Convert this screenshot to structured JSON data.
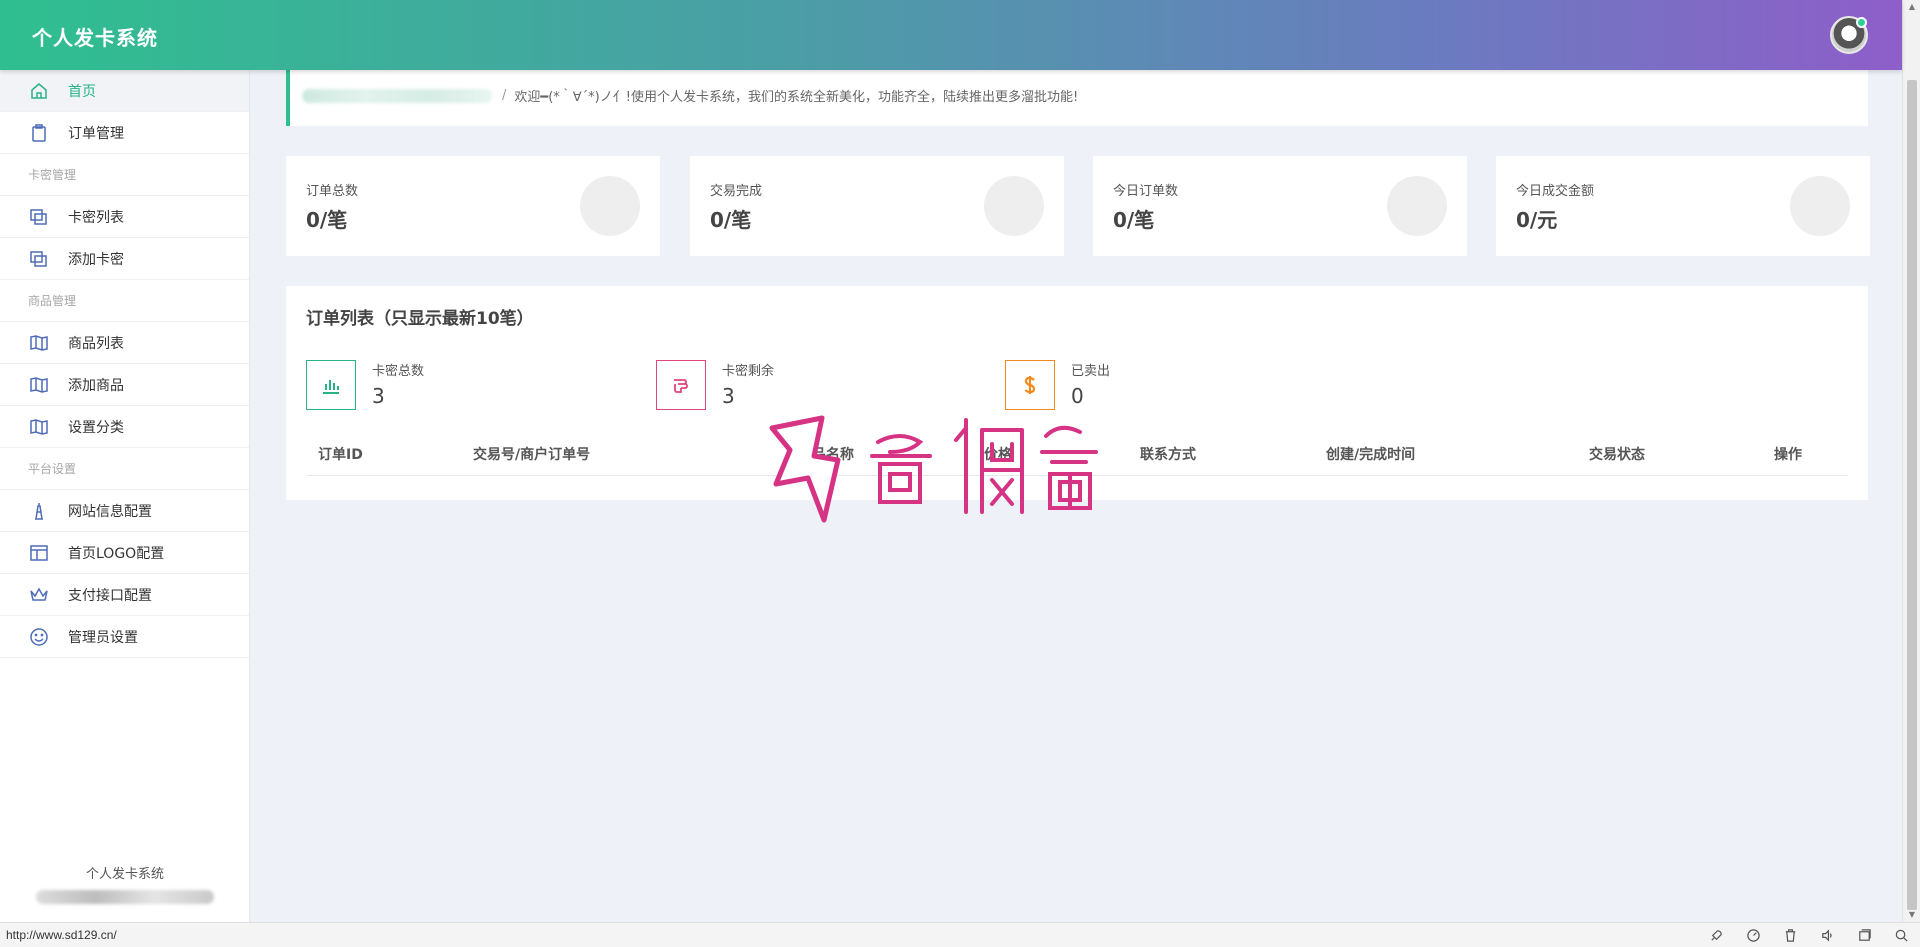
{
  "app": {
    "brand": "个人发卡系统"
  },
  "sidebar": {
    "items": [
      {
        "label": "首页",
        "icon": "home-icon",
        "active": true
      },
      {
        "label": "订单管理",
        "icon": "clipboard-icon"
      },
      {
        "group": "卡密管理"
      },
      {
        "label": "卡密列表",
        "icon": "cards-icon"
      },
      {
        "label": "添加卡密",
        "icon": "cards-icon"
      },
      {
        "group": "商品管理"
      },
      {
        "label": "商品列表",
        "icon": "map-icon"
      },
      {
        "label": "添加商品",
        "icon": "map-icon"
      },
      {
        "label": "设置分类",
        "icon": "map-icon"
      },
      {
        "group": "平台设置"
      },
      {
        "label": "网站信息配置",
        "icon": "tower-icon"
      },
      {
        "label": "首页LOGO配置",
        "icon": "layout-icon"
      },
      {
        "label": "支付接口配置",
        "icon": "crown-icon"
      },
      {
        "label": "管理员设置",
        "icon": "smile-icon"
      }
    ],
    "footer": "个人发卡系统"
  },
  "welcome": {
    "separator": "/",
    "message": "欢迎━(*｀∀´*)ノ亻!使用个人发卡系统，我们的系统全新美化，功能齐全，陆续推出更多溜批功能!"
  },
  "stats": [
    {
      "label": "订单总数",
      "value": "0/笔"
    },
    {
      "label": "交易完成",
      "value": "0/笔"
    },
    {
      "label": "今日订单数",
      "value": "0/笔"
    },
    {
      "label": "今日成交金额",
      "value": "0/元"
    }
  ],
  "orders": {
    "title": "订单列表（只显示最新10笔）",
    "summary": [
      {
        "label": "卡密总数",
        "value": "3",
        "icon": "bar-chart-icon",
        "color": "#27b386"
      },
      {
        "label": "卡密剩余",
        "value": "3",
        "icon": "hand-icon",
        "color": "#e0457b"
      },
      {
        "label": "已卖出",
        "value": "0",
        "icon": "dollar-icon",
        "color": "#f08a1c"
      }
    ],
    "columns": [
      "订单ID",
      "交易号/商户订单号",
      "商品名称",
      "价格",
      "联系方式",
      "创建/完成时间",
      "交易状态",
      "操作"
    ]
  },
  "statusbar": {
    "url": "http://www.sd129.cn/"
  },
  "colors": {
    "accent": "#27b386",
    "gradient_start": "#2fbf8f",
    "gradient_end": "#8e5ec9",
    "watermark": "#d63384"
  }
}
